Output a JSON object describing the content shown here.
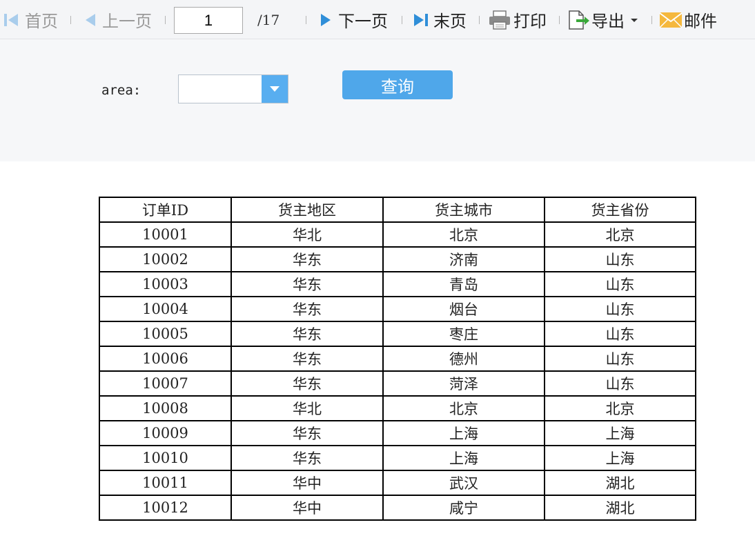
{
  "toolbar": {
    "first_page": "首页",
    "prev_page": "上一页",
    "current_page": "1",
    "total_pages": "/17",
    "next_page": "下一页",
    "last_page": "末页",
    "print": "打印",
    "export": "导出",
    "mail": "邮件"
  },
  "filter": {
    "area_label": "area:",
    "area_value": "",
    "query_label": "查询"
  },
  "table": {
    "headers": [
      "订单ID",
      "货主地区",
      "货主城市",
      "货主省份"
    ],
    "rows": [
      [
        "10001",
        "华北",
        "北京",
        "北京"
      ],
      [
        "10002",
        "华东",
        "济南",
        "山东"
      ],
      [
        "10003",
        "华东",
        "青岛",
        "山东"
      ],
      [
        "10004",
        "华东",
        "烟台",
        "山东"
      ],
      [
        "10005",
        "华东",
        "枣庄",
        "山东"
      ],
      [
        "10006",
        "华东",
        "德州",
        "山东"
      ],
      [
        "10007",
        "华东",
        "菏泽",
        "山东"
      ],
      [
        "10008",
        "华北",
        "北京",
        "北京"
      ],
      [
        "10009",
        "华东",
        "上海",
        "上海"
      ],
      [
        "10010",
        "华东",
        "上海",
        "上海"
      ],
      [
        "10011",
        "华中",
        "武汉",
        "湖北"
      ],
      [
        "10012",
        "华中",
        "咸宁",
        "湖北"
      ]
    ]
  },
  "colors": {
    "accent": "#4fa7ea",
    "toolbar_bg": "#f4f5f7",
    "panel_bg": "#f6f7f9",
    "disabled_text": "#9a9a9a",
    "nav_icon": "#2f8ed8"
  }
}
